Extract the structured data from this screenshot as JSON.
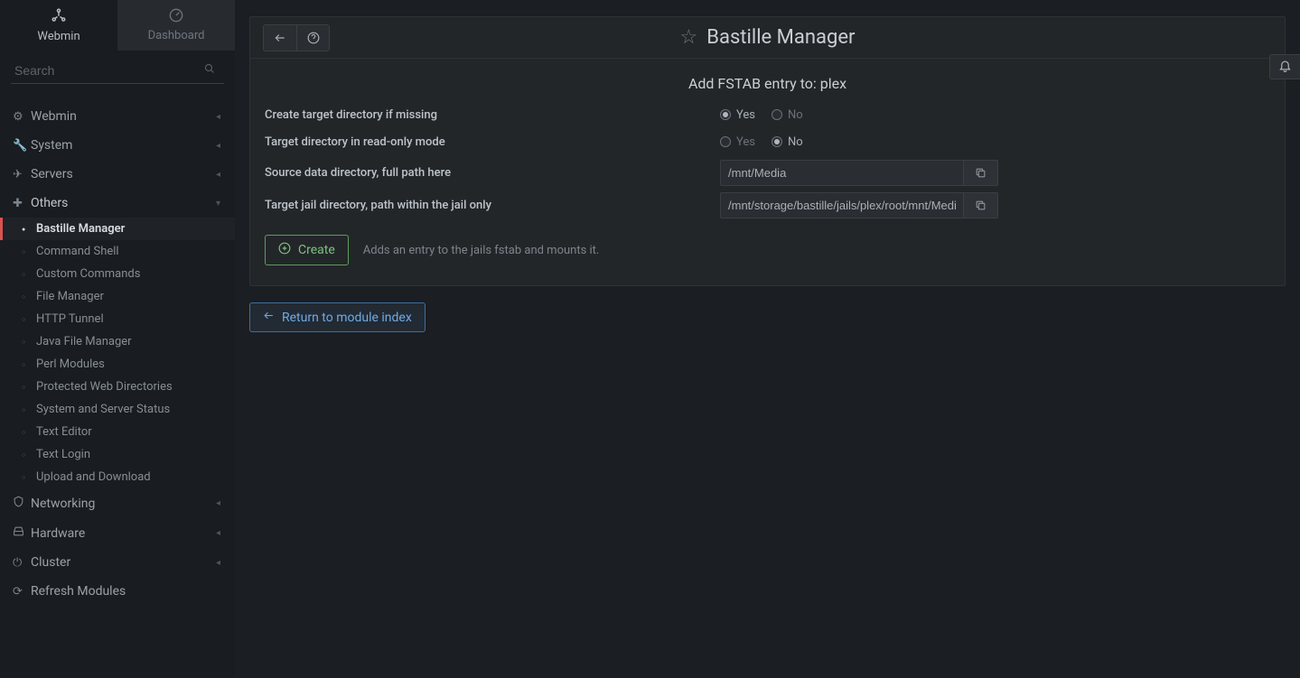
{
  "tabs": {
    "webmin": "Webmin",
    "dashboard": "Dashboard"
  },
  "search": {
    "placeholder": "Search"
  },
  "nav": {
    "webmin": "Webmin",
    "system": "System",
    "servers": "Servers",
    "others": "Others",
    "networking": "Networking",
    "hardware": "Hardware",
    "cluster": "Cluster",
    "refresh": "Refresh Modules"
  },
  "others_items": [
    "Bastille Manager",
    "Command Shell",
    "Custom Commands",
    "File Manager",
    "HTTP Tunnel",
    "Java File Manager",
    "Perl Modules",
    "Protected Web Directories",
    "System and Server Status",
    "Text Editor",
    "Text Login",
    "Upload and Download"
  ],
  "page": {
    "title": "Bastille Manager",
    "section_title": "Add FSTAB entry to: plex",
    "rows": {
      "create_dir": "Create target directory if missing",
      "readonly": "Target directory in read-only mode",
      "source": "Source data directory, full path here",
      "target": "Target jail directory, path within the jail only"
    },
    "opts": {
      "yes": "Yes",
      "no": "No"
    },
    "inputs": {
      "source": "/mnt/Media",
      "target": "/mnt/storage/bastille/jails/plex/root/mnt/Media"
    },
    "create_btn": "Create",
    "create_hint": "Adds an entry to the jails fstab and mounts it.",
    "return_btn": "Return to module index"
  }
}
